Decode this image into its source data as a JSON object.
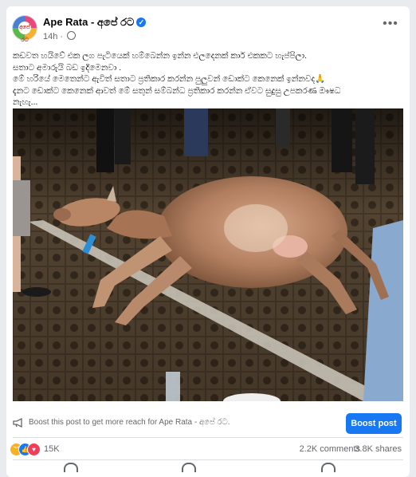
{
  "header": {
    "page_name": "Ape Rata - අපේ රට",
    "avatar_text": "අපේ රට",
    "time": "14h",
    "separator": "·",
    "more_label": "•••"
  },
  "post": {
    "lines": [
      "කඩවත හයිවේ එක ලග පැටියෙක් හම්බෙන්න ඉන්න එලදෙනක් කාර් එකකට හැප්පිලා.",
      "සතාට අමාරුයි බඩ ඉදිමෙනවා .",
      "මේ හරියේ මෙතෙන්ට ඇවිත් සතාට ප්‍රතිකාර කරන්න පුලුවන් ඩොක්ට කෙනෙක් ඉන්නවද",
      "දැනට ඩොක්ට කෙනෙක් ආවත් මේ සතුන් සම්බන්ධ ප්‍රතිකාර කරන්න ඒවට සුදුසු උපකරණ ඖෂධ",
      "නැහැ..."
    ],
    "line3_emoji": "🙏"
  },
  "boost": {
    "text": "Boost this post to get more reach for Ape Rata - අපේ රට.",
    "button_label": "Boost post"
  },
  "stats": {
    "reaction_count": "15K",
    "comments": "2.2K comments",
    "shares": "3.8K shares",
    "reaction_icons": [
      "sad-icon",
      "like-icon",
      "love-icon"
    ]
  },
  "colors": {
    "accent": "#1877f2",
    "text_secondary": "#65676b",
    "background": "#e9ebee"
  }
}
